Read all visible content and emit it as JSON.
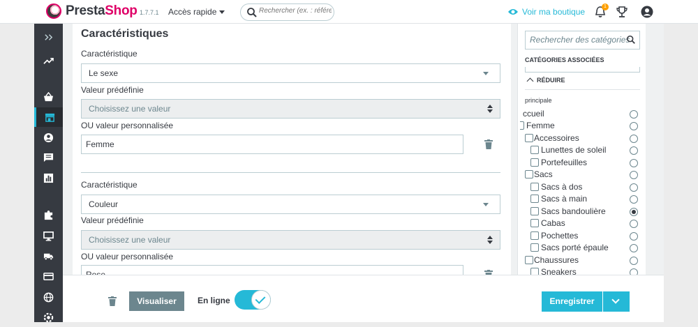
{
  "header": {
    "brand_presta": "Presta",
    "brand_shop": "Shop",
    "version": "1.7.7.1",
    "quick_access": "Accès rapide",
    "search_placeholder": "Rechercher (ex. : référe",
    "view_shop": "Voir ma boutique",
    "notifications_count": "1"
  },
  "sidebar": {
    "icons": [
      "expand-icon",
      "stats-trend-icon",
      "orders-basket-icon",
      "catalog-store-icon",
      "customers-icon",
      "messages-icon",
      "stats-icon",
      "modules-icon",
      "design-icon",
      "shipping-icon",
      "payment-icon",
      "international-icon",
      "parameters-icon"
    ],
    "active_index": 3
  },
  "features": {
    "title": "Caractéristiques",
    "blocks": [
      {
        "feature_label": "Caractéristique",
        "feature_value": "Le sexe",
        "predefined_label": "Valeur prédéfinie",
        "predefined_value": "Choisissez une valeur",
        "custom_label": "OU valeur personnalisée",
        "custom_value": "Femme"
      },
      {
        "feature_label": "Caractéristique",
        "feature_value": "Couleur",
        "predefined_label": "Valeur prédéfinie",
        "predefined_value": "Choisissez une valeur",
        "custom_label": "OU valeur personnalisée",
        "custom_value": "Rose"
      }
    ]
  },
  "categories": {
    "search_placeholder": "Rechercher des catégories",
    "associated_header": "CATÉGORIES ASSOCIÉES",
    "reduce_label": "RÉDUIRE",
    "main_label": "principale",
    "tree": [
      {
        "label": "ccueil",
        "checkbox": false,
        "radio": false
      },
      {
        "label": "Femme",
        "checkbox": true,
        "radio": false
      },
      {
        "label": "Accessoires",
        "checkbox": true,
        "radio": false
      },
      {
        "label": "Lunettes de soleil",
        "checkbox": true,
        "radio": false
      },
      {
        "label": "Portefeuilles",
        "checkbox": true,
        "radio": false
      },
      {
        "label": "Sacs",
        "checkbox": true,
        "radio": false
      },
      {
        "label": "Sacs à dos",
        "checkbox": true,
        "radio": false
      },
      {
        "label": "Sacs à main",
        "checkbox": true,
        "radio": false
      },
      {
        "label": "Sacs bandoulière",
        "checkbox": true,
        "radio": true
      },
      {
        "label": "Cabas",
        "checkbox": true,
        "radio": false
      },
      {
        "label": "Pochettes",
        "checkbox": true,
        "radio": false
      },
      {
        "label": "Sacs porté épaule",
        "checkbox": true,
        "radio": false
      },
      {
        "label": "Chaussures",
        "checkbox": true,
        "radio": false
      },
      {
        "label": "Sneakers",
        "checkbox": true,
        "radio": false
      }
    ]
  },
  "footer": {
    "preview_label": "Visualiser",
    "online_label": "En ligne",
    "online_enabled": true,
    "save_label": "Enregistrer"
  },
  "colors": {
    "accent": "#25b9d7",
    "sidebar": "#363a41",
    "brand_pink": "#df0067"
  }
}
